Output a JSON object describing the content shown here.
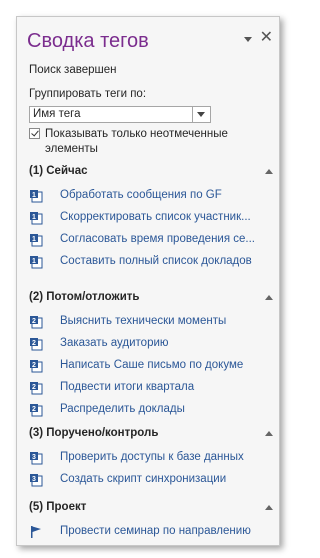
{
  "panel": {
    "title": "Сводка тегов",
    "status": "Поиск завершен",
    "group_label": "Группировать теги по:",
    "group_select_value": "Имя тега",
    "show_unchecked_label": "Показывать только неотмеченные элементы",
    "show_unchecked_checked": true
  },
  "sections": [
    {
      "title": "(1) Сейчас",
      "icon_digit": "1",
      "items": [
        "Обработать сообщения по GF",
        "Скорректировать список участник...",
        "Согласовать время проведения се...",
        "Составить полный список докладов"
      ]
    },
    {
      "title": "(2) Потом/отложить",
      "icon_digit": "2",
      "items": [
        "Выяснить технически моменты",
        "Заказать аудиторию",
        "Написать Саше письмо по докуме",
        "Подвести итоги квартала",
        "Распределить доклады"
      ]
    },
    {
      "title": "(3) Поручено/контроль",
      "icon_digit": "3",
      "items": [
        "Проверить доступы к базе данных",
        "Создать скрипт синхронизации"
      ]
    },
    {
      "title": "(5) Проект",
      "icon_digit": "flag",
      "items": [
        "Провести семинар по направлению"
      ]
    }
  ],
  "colors": {
    "title": "#7b2d8e",
    "link": "#2b5797",
    "tag_icon": "#2b5797"
  }
}
